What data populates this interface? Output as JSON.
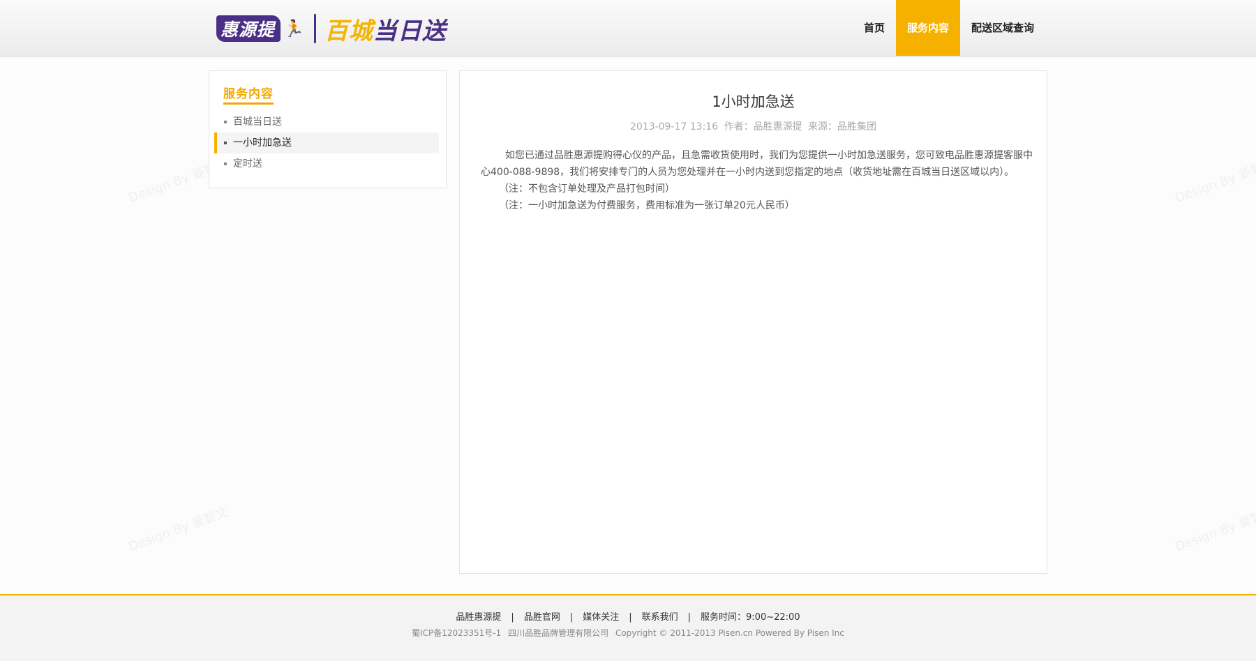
{
  "header": {
    "logo_main": "惠源提",
    "logo_sub_part1": "百城",
    "logo_sub_part2": "当日送",
    "nav": [
      {
        "label": "首页"
      },
      {
        "label": "服务内容",
        "active": true
      },
      {
        "label": "配送区域查询"
      }
    ]
  },
  "sidebar": {
    "title": "服务内容",
    "items": [
      {
        "label": "百城当日送"
      },
      {
        "label": "一小时加急送",
        "active": true
      },
      {
        "label": "定时送"
      }
    ]
  },
  "article": {
    "title": "1小时加急送",
    "date": "2013-09-17 13:16",
    "author": "作者：品胜惠源提",
    "source": "来源：品胜集团",
    "paragraphs": [
      "如您已通过品胜惠源提购得心仪的产品，且急需收货使用时，我们为您提供一小时加急送服务，您可致电品胜惠源提客服中心400-088-9898，我们将安排专门的人员为您处理并在一小时内送到您指定的地点（收货地址需在百城当日送区域以内）。",
      "（注：不包含订单处理及产品打包时间）",
      "（注：一小时加急送为付费服务，费用标准为一张订单20元人民币）"
    ]
  },
  "footer": {
    "links": [
      "品胜惠源提",
      "品胜官网",
      "媒体关注",
      "联系我们",
      "服务时间：9:00~22:00"
    ],
    "icp": "蜀ICP备12023351号-1",
    "company": "四川品胜品牌管理有限公司",
    "copyright": "Copyright © 2011-2013 Pisen.cn Powered By Pisen Inc"
  },
  "watermark": "Design By 姜智文",
  "colors": {
    "accent": "#f6b100",
    "brand_purple": "#4a2f86"
  }
}
